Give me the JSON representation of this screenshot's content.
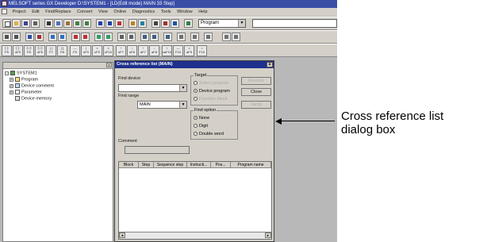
{
  "window": {
    "title": "MELSOFT series GX Developer D:\\SYSTEM1 - [LD(Edit mode)    MAIN    33 Step]"
  },
  "menu": [
    "Project",
    "Edit",
    "Find/Replace",
    "Convert",
    "View",
    "Online",
    "Diagnostics",
    "Tools",
    "Window",
    "Help"
  ],
  "toolbar": {
    "program_combo": "Program"
  },
  "tree": {
    "root": "SYSTEM1",
    "items": [
      {
        "label": "Program",
        "expander": "+"
      },
      {
        "label": "Device comment",
        "expander": "+"
      },
      {
        "label": "Parameter",
        "expander": "+"
      },
      {
        "label": "Device memory",
        "expander": ""
      }
    ]
  },
  "dialog": {
    "title": "Cross reference list (MAIN)",
    "close_glyph": "×",
    "find_device_label": "Find device",
    "find_device_value": "",
    "find_range_label": "Find range",
    "find_range_value": "MAIN",
    "target": {
      "label": "Target",
      "options": [
        {
          "label": "Select program",
          "checked": false,
          "disabled": true
        },
        {
          "label": "Device program",
          "checked": true,
          "disabled": false
        },
        {
          "label": "Function block",
          "checked": false,
          "disabled": true
        }
      ]
    },
    "find_option": {
      "label": "Find option",
      "options": [
        {
          "label": "None",
          "checked": true
        },
        {
          "label": "Digit",
          "checked": false
        },
        {
          "label": "Double word",
          "checked": false
        }
      ]
    },
    "buttons": {
      "execute": "Execute",
      "close": "Close",
      "jump": "Jump"
    },
    "comment_label": "Comment",
    "comment_value": "",
    "columns": [
      "Block",
      "Step",
      "Sequence step",
      "Instructi...",
      "Pos...",
      "Program name"
    ]
  },
  "callout": {
    "line1": "Cross reference list",
    "line2": "dialog box"
  },
  "colors": {
    "title_bar": "#1e2f8c",
    "app_title_bar": "#3a4ea8",
    "face": "#d4d0c8"
  }
}
